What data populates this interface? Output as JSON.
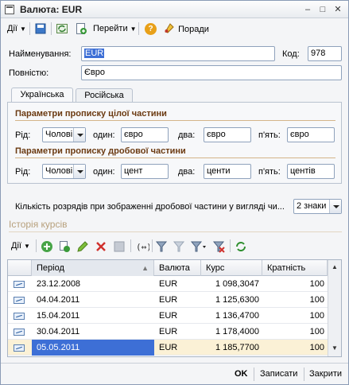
{
  "window": {
    "title": "Валюта: EUR",
    "minimize": "–",
    "maximize": "□",
    "close": "✕"
  },
  "toolbar": {
    "actions_label": "Дії",
    "goto_label": "Перейти",
    "help_label": "?",
    "tips_label": "Поради"
  },
  "form": {
    "name_label": "Найменування:",
    "name_value": "EUR",
    "code_label": "Код:",
    "code_value": "978",
    "full_label": "Повністю:",
    "full_value": "Євро"
  },
  "tabs": [
    {
      "label": "Українська"
    },
    {
      "label": "Російська"
    }
  ],
  "integer_part": {
    "title": "Параметри прописку цілої частини",
    "gender_label": "Рід:",
    "gender_value": "Чолові",
    "one_label": "один:",
    "one_value": "євро",
    "two_label": "два:",
    "two_value": "євро",
    "five_label": "п'ять:",
    "five_value": "євро"
  },
  "fraction_part": {
    "title": "Параметри прописку дробової частини",
    "gender_label": "Рід:",
    "gender_value": "Чолові",
    "one_label": "один:",
    "one_value": "цент",
    "two_label": "два:",
    "two_value": "центи",
    "five_label": "п'ять:",
    "five_value": "центів"
  },
  "digits": {
    "label": "Кількість розрядів при зображенні дробової частини у вигляді чи...",
    "value": "2 знаки"
  },
  "history": {
    "title": "Історія курсів",
    "actions_label": "Дії",
    "columns": [
      "Період",
      "Валюта",
      "Курс",
      "Кратність"
    ],
    "rows": [
      {
        "period": "23.12.2008",
        "currency": "EUR",
        "rate": "1 098,3047",
        "mult": "100"
      },
      {
        "period": "04.04.2011",
        "currency": "EUR",
        "rate": "1 125,6300",
        "mult": "100"
      },
      {
        "period": "15.04.2011",
        "currency": "EUR",
        "rate": "1 136,4700",
        "mult": "100"
      },
      {
        "period": "30.04.2011",
        "currency": "EUR",
        "rate": "1 178,4000",
        "mult": "100"
      },
      {
        "period": "05.05.2011",
        "currency": "EUR",
        "rate": "1 185,7700",
        "mult": "100"
      }
    ]
  },
  "footer": {
    "ok_label": "OK",
    "save_label": "Записати",
    "close_label": "Закрити"
  },
  "colors": {
    "section_title": "#6b3a11",
    "selected_cell": "#3d6fd6",
    "history_title": "#b7a07c"
  }
}
